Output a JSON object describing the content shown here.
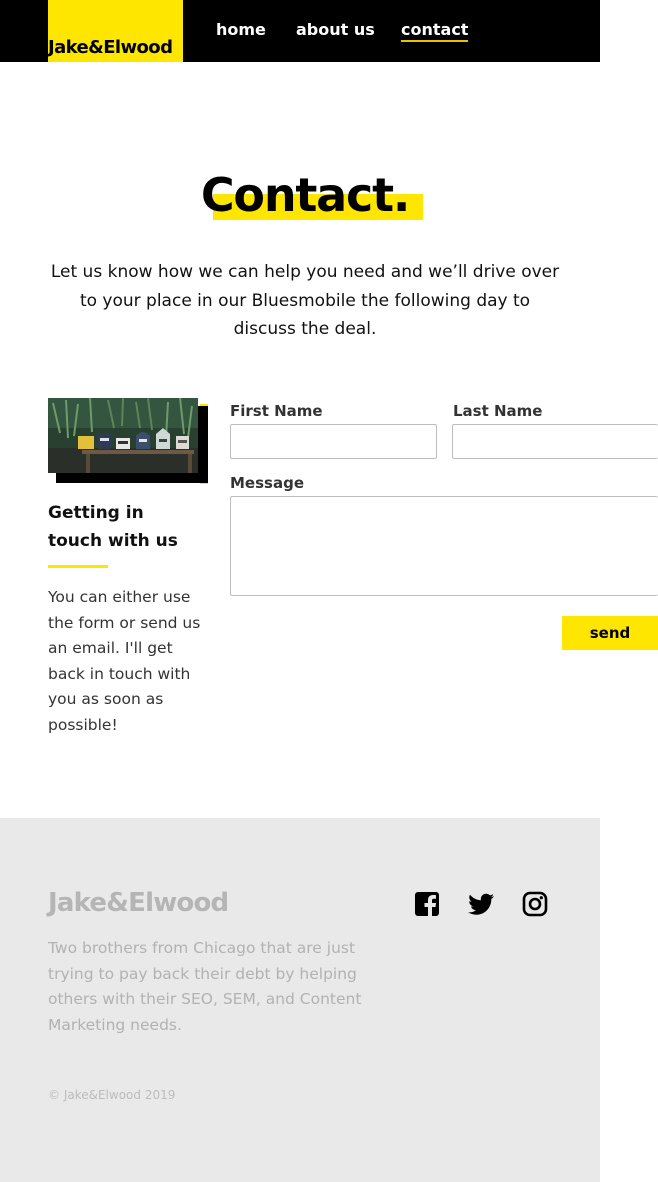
{
  "brand": {
    "logo": "Jake&Elwood",
    "accent_color": "#ffe600",
    "header_bg": "#000000",
    "footer_bg": "#e9e9e9"
  },
  "nav": {
    "items": [
      "home",
      "about us",
      "contact"
    ],
    "active": "contact"
  },
  "hero": {
    "title": "Contact.",
    "text": "Let us know how we can help you need and we’ll drive over to your place in our Bluesmobile the following day to discuss the deal."
  },
  "sidebar": {
    "image_icon": "mailboxes-photo",
    "heading_line1": "Getting in",
    "heading_line2": "touch with us",
    "text": "You can either use the form or send us an email. I'll get back in touch with you as soon as possible!"
  },
  "form": {
    "first_name_label": "First Name",
    "first_name_value": "",
    "last_name_label": "Last Name",
    "last_name_value": "",
    "message_label": "Message",
    "message_value": "",
    "send_label": "send"
  },
  "footer": {
    "logo": "Jake&Elwood",
    "text": "Two brothers from Chicago that are just trying to pay back their debt by helping others with their SEO, SEM, and Content Marketing needs.",
    "copyright": "© Jake&Elwood 2019",
    "social_icons": [
      "facebook-icon",
      "twitter-icon",
      "instagram-icon"
    ]
  }
}
